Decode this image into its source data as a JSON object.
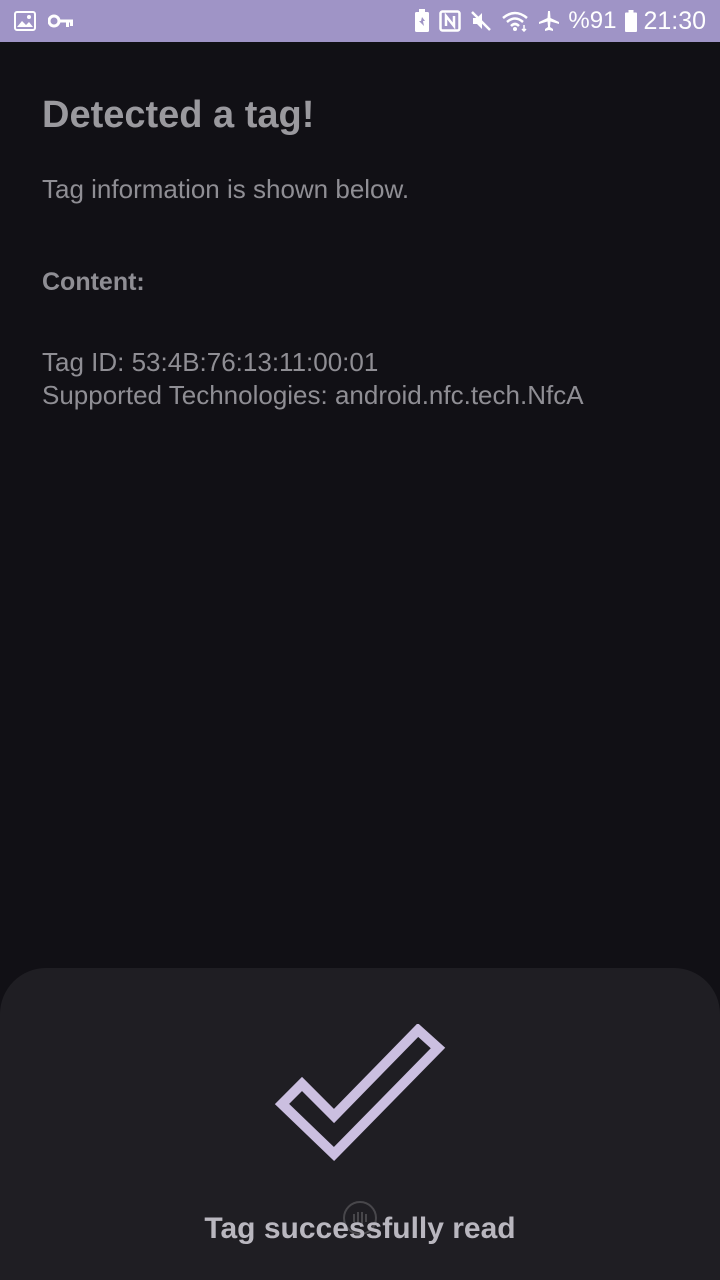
{
  "status_bar": {
    "left_icons": [
      "image-icon",
      "vpn-key-icon"
    ],
    "right_icons": [
      "battery-saver-icon",
      "nfc-icon",
      "mute-icon",
      "wifi-icon",
      "airplane-icon",
      "battery-icon"
    ],
    "battery": "%91",
    "time": "21:30",
    "color": "#9f94c6"
  },
  "main": {
    "title": "Detected a tag!",
    "subtitle": "Tag information is shown below.",
    "content_label": "Content:",
    "tag_id": "Tag ID: 53:4B:76:13:11:00:01",
    "technologies": "Supported Technologies: android.nfc.tech.NfcA"
  },
  "sheet": {
    "icon": "checkmark-icon",
    "message": "Tag successfully read",
    "check_color": "#cbbfe0"
  }
}
